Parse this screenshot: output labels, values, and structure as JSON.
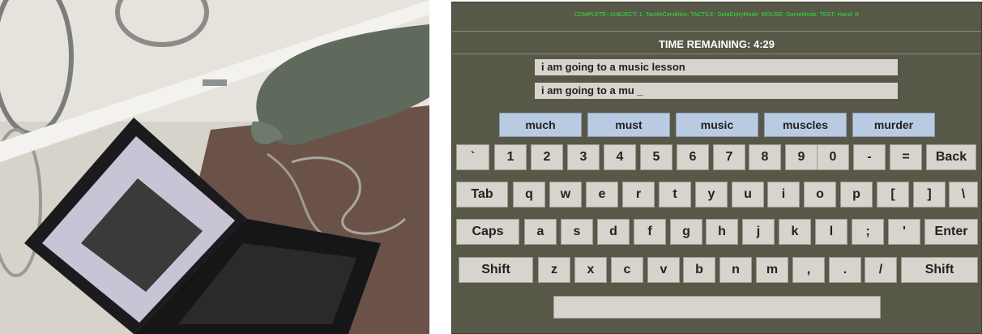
{
  "photo": {
    "description_icon": "glove-on-laptop-photo"
  },
  "app": {
    "status_text": "COMPLETE--SUBJECT: 1- TactileCondition: TACTILE- DataEntryMode: MOUSE- GameMode: TEST- Hand: R",
    "timer_text": "TIME REMAINING: 4:29",
    "target_phrase": "i am going to a music lesson",
    "typed_text": "i am going to a mu _",
    "suggestions": [
      "much",
      "must",
      "music",
      "muscles",
      "murder"
    ],
    "keyboard": {
      "row1": [
        "`",
        "1",
        "2",
        "3",
        "4",
        "5",
        "6",
        "7",
        "8",
        "9",
        "0",
        "-",
        "=",
        "Back"
      ],
      "row2": [
        "Tab",
        "q",
        "w",
        "e",
        "r",
        "t",
        "y",
        "u",
        "i",
        "o",
        "p",
        "[",
        "]",
        "\\"
      ],
      "row3": [
        "Caps",
        "a",
        "s",
        "d",
        "f",
        "g",
        "h",
        "j",
        "k",
        "l",
        ";",
        "'",
        "Enter"
      ],
      "row4": [
        "Shift",
        "z",
        "x",
        "c",
        "v",
        "b",
        "n",
        "m",
        ",",
        ".",
        "/",
        "Shift"
      ]
    },
    "colors": {
      "background": "#575848",
      "status_text": "#2ee63a",
      "key": "#d6d4cd",
      "suggestion": "#b9cbe3"
    }
  }
}
